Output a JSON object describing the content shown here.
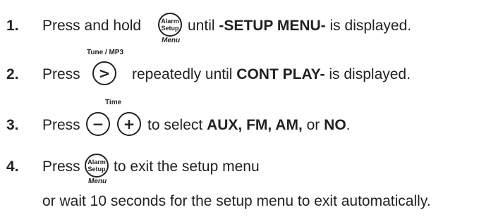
{
  "steps": [
    {
      "number": "1.",
      "pre": "Press and hold",
      "post_plain": "until",
      "post_bold": "-SETUP MENU-",
      "post_tail": "is displayed.",
      "button": {
        "line1": "Alarm",
        "line2": "Setup",
        "below": "Menu",
        "icon": "alarm-setup-button-icon"
      }
    },
    {
      "number": "2.",
      "above": "Tune / MP3",
      "pre": "Press",
      "post_plain": "repeatedly until",
      "post_bold": "CONT PLAY-",
      "post_tail": "is displayed.",
      "button": {
        "symbol": ">",
        "icon": "next-button-icon"
      }
    },
    {
      "number": "3.",
      "above": "Time",
      "pre": "Press",
      "post_plain": "to select",
      "post_bold": "AUX, FM, AM,",
      "post_mid": "or",
      "post_bold2": "NO",
      "post_tail": ".",
      "buttons": [
        {
          "symbol": "−",
          "icon": "minus-button-icon"
        },
        {
          "symbol": "+",
          "icon": "plus-button-icon"
        }
      ]
    },
    {
      "number": "4.",
      "pre": "Press",
      "post_plain": "to exit the setup menu",
      "continuation": "or wait 10 seconds for the setup menu to exit automatically.",
      "button": {
        "line1": "Alarm",
        "line2": "Setup",
        "below": "Menu",
        "icon": "alarm-setup-button-icon"
      }
    }
  ]
}
